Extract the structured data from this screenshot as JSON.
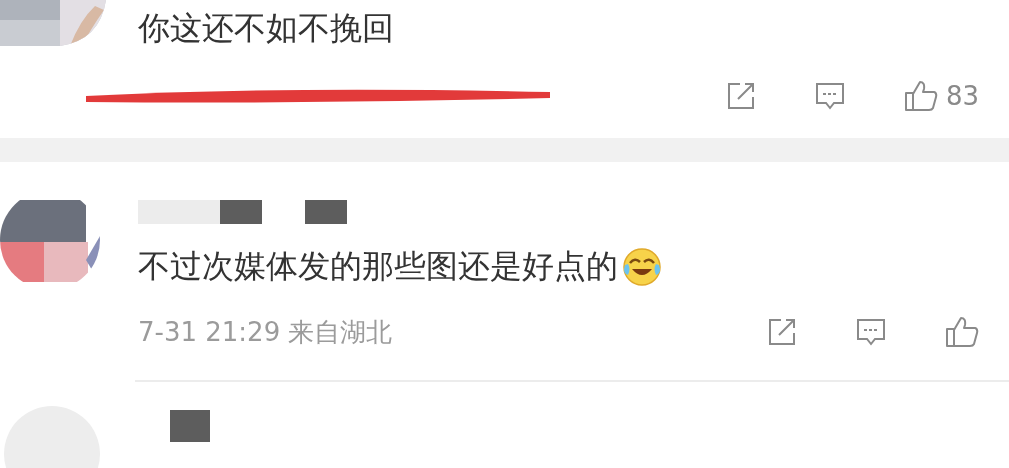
{
  "comments": [
    {
      "text": "你这还不如不挽回",
      "meta_scribbled": true,
      "likes": "83"
    },
    {
      "text": "不过次媒体发的那些图还是好点的",
      "name_redacted": true,
      "meta": "7-31 21:29 来自湖北",
      "emoji": true
    }
  ],
  "next_comment": {
    "name_redacted": true
  }
}
